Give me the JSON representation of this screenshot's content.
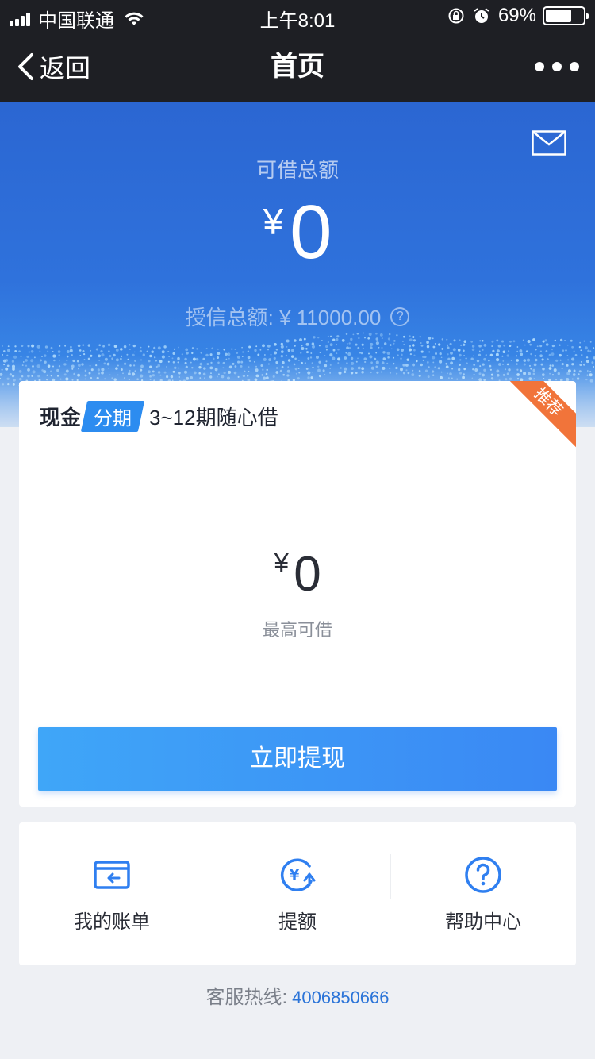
{
  "status_bar": {
    "carrier": "中国联通",
    "time": "上午8:01",
    "battery": "69%",
    "battery_level": 0.69
  },
  "nav": {
    "back_label": "返回",
    "title": "首页"
  },
  "hero": {
    "label": "可借总额",
    "currency": "¥",
    "amount": "0",
    "credit_label": "授信总额: ¥ 11000.00",
    "help_glyph": "?"
  },
  "loan_card": {
    "product_prefix": "现金",
    "product_tag": "分期",
    "product_desc": "3~12期随心借",
    "badge": "推荐",
    "currency": "¥",
    "amount": "0",
    "amount_caption": "最高可借",
    "action_label": "立即提现"
  },
  "shortcuts": [
    {
      "label": "我的账单",
      "icon": "bill-icon"
    },
    {
      "label": "提额",
      "icon": "raise-limit-icon"
    },
    {
      "label": "帮助中心",
      "icon": "help-icon"
    }
  ],
  "hotline": {
    "label": "客服热线:",
    "number": "4006850666"
  },
  "colors": {
    "accent": "#3a88f4",
    "nav_bg": "#1e1f24",
    "badge": "#f1743a",
    "link": "#2b74d8"
  }
}
